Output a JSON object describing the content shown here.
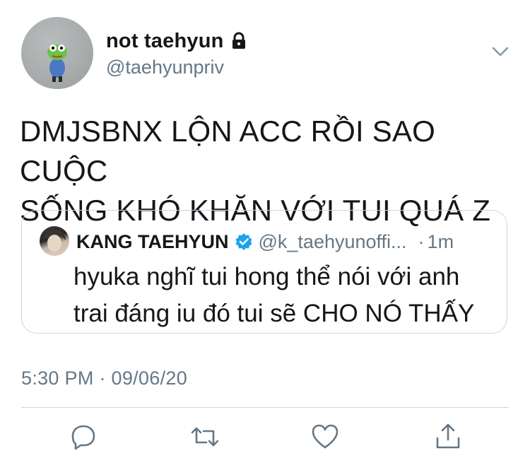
{
  "tweet": {
    "display_name": "not taehyun",
    "handle": "@taehyunpriv",
    "text_line1": "DMJSBNX LỘN ACC RỒI SAO CUỘC",
    "text_line2": "SỐNG KHÓ KHĂN VỚI TUI QUÁ Z",
    "timestamp": "5:30 PM · 09/06/20"
  },
  "quoted": {
    "name": "KANG TAEHYUN",
    "handle": "@k_taehyunoffi...",
    "separator": "·",
    "time": "1m",
    "text_line1": "hyuka nghĩ tui hong thể nói với anh",
    "text_line2": "trai đáng iu đó tui sẽ CHO NÓ THẤY"
  },
  "icons": {
    "lock": "lock-icon",
    "more": "chevron-down-icon",
    "verified": "verified-badge-icon",
    "reply": "reply-icon",
    "retweet": "retweet-icon",
    "like": "heart-icon",
    "share": "share-icon"
  },
  "colors": {
    "text": "#14171a",
    "secondary": "#657786",
    "border": "#ccd6dd",
    "verified": "#1da1f2"
  }
}
